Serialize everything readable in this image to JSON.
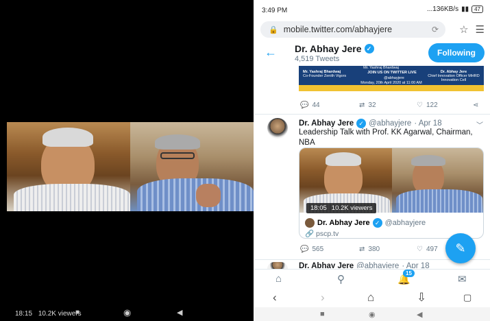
{
  "left": {
    "stream_time": "18:15",
    "viewers": "10.2K viewers"
  },
  "status": {
    "time": "3:49 PM",
    "speed": "...136KB/s",
    "battery": "47"
  },
  "browser": {
    "url": "mobile.twitter.com/abhayjere"
  },
  "profile": {
    "name": "Dr. Abhay Jere",
    "tweet_count": "4,519 Tweets",
    "follow_label": "Following"
  },
  "banner": {
    "left_name": "Mr. Yashraj Bhardwaj",
    "left_role": "Co-Founder Zenith Vigors",
    "center": "JOIN US ON TWITTER LIVE",
    "handle": "@abhayjere",
    "date": "Monday, 20th April 2020 at 11:00 AM",
    "right_name": "Dr. Abhay Jere",
    "right_role": "Chief Innovation Officer MHRD Innovation Cell",
    "top": "Mr. Yashraj Bhardwaj"
  },
  "tweet1_actions": {
    "replies": "44",
    "retweets": "32",
    "likes": "122"
  },
  "tweet2": {
    "name": "Dr. Abhay Jere",
    "handle": "@abhayjere",
    "date": "· Apr 18",
    "text": "Leadership Talk with Prof. KK Agarwal, Chairman, NBA",
    "badge_time": "18:05",
    "badge_viewers": "10.2K viewers",
    "card_name": "Dr. Abhay Jere",
    "card_handle": "@abhayjere",
    "card_link": "pscp.tv",
    "replies": "565",
    "retweets": "380",
    "likes": "497"
  },
  "tweet3": {
    "name": "Dr. Abhay Jere",
    "handle": "@abhayjere",
    "date": "· Apr 18"
  },
  "tabs": {
    "notifications_count": "15"
  },
  "colors": {
    "accent": "#1da1f2",
    "text": "#14171a",
    "muted": "#657786"
  },
  "icons": {
    "home": "home-icon",
    "search": "search-icon",
    "notifications": "bell-icon",
    "messages": "mail-icon",
    "compose": "compose-icon"
  }
}
